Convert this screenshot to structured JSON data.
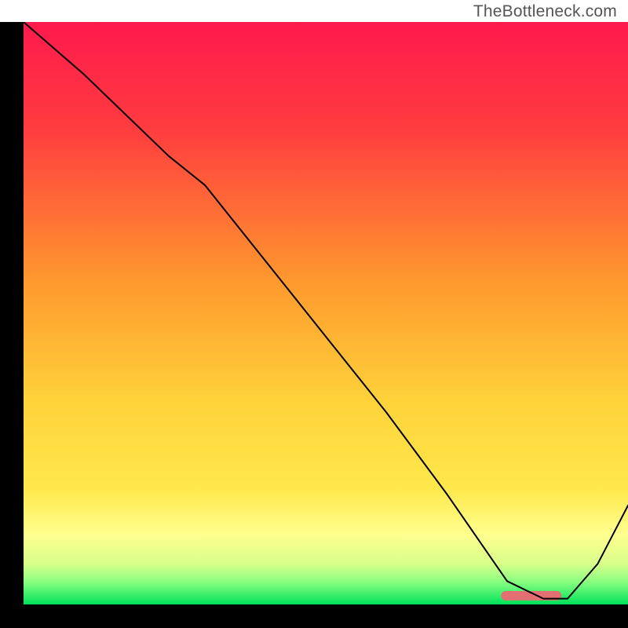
{
  "watermark": "TheBottleneck.com",
  "chart_data": {
    "type": "line",
    "title": "",
    "xlabel": "",
    "ylabel": "",
    "xlim": [
      0,
      100
    ],
    "ylim": [
      0,
      100
    ],
    "grid": false,
    "legend": false,
    "background_gradient": {
      "top_rgb": "#ff1a4d",
      "mid_rgb": "#ffe03a",
      "lower_rgb": "#ffff8f",
      "bottom_rgb": "#00e25a"
    },
    "series": [
      {
        "name": "curve",
        "stroke": "#000000",
        "stroke_width": 2,
        "x": [
          0,
          10,
          24,
          30,
          40,
          50,
          60,
          70,
          76,
          80,
          86,
          90,
          95,
          100
        ],
        "y": [
          100,
          91,
          77,
          72,
          59,
          46,
          33,
          19,
          10,
          4,
          1,
          1,
          7,
          17
        ]
      }
    ],
    "marker_bar": {
      "comment": "short rounded pink bar sitting at the valley floor",
      "x_start": 79,
      "x_end": 89,
      "y": 1.5,
      "color": "#e36f72",
      "thickness": 12
    }
  }
}
